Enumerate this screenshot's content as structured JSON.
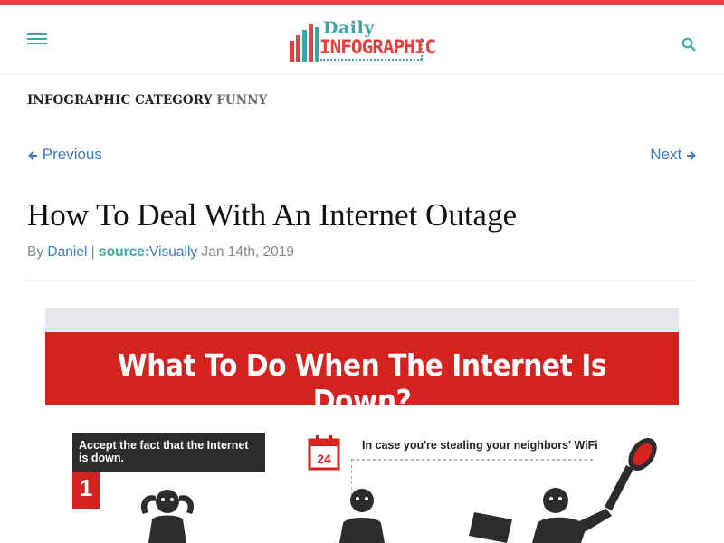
{
  "header": {
    "logo": {
      "line1": "Daily",
      "line2": "INFOGRAPHIC"
    },
    "menu_icon": "hamburger-menu-icon",
    "search_icon": "search-icon"
  },
  "category": {
    "label": "INFOGRAPHIC CATEGORY",
    "value": "FUNNY"
  },
  "nav": {
    "previous": "Previous",
    "next": "Next"
  },
  "post": {
    "title": "How To Deal With An Internet Outage",
    "by": "By",
    "author": "Daniel",
    "separator": "|",
    "source_label": "source:",
    "source_name": "Visually",
    "date": "Jan 14th, 2019"
  },
  "infographic": {
    "heading": "What To Do When The Internet Is Down?",
    "step1_text": "Accept the fact that the Internet is down.",
    "step1_number": "1",
    "calendar_number": "24",
    "step2_text": "In case you're stealing your neighbors' WiFi"
  },
  "colors": {
    "accent_red": "#e8403f",
    "accent_teal": "#3aa6a6",
    "link_blue": "#3a7cc0",
    "banner_red": "#d4221f"
  }
}
